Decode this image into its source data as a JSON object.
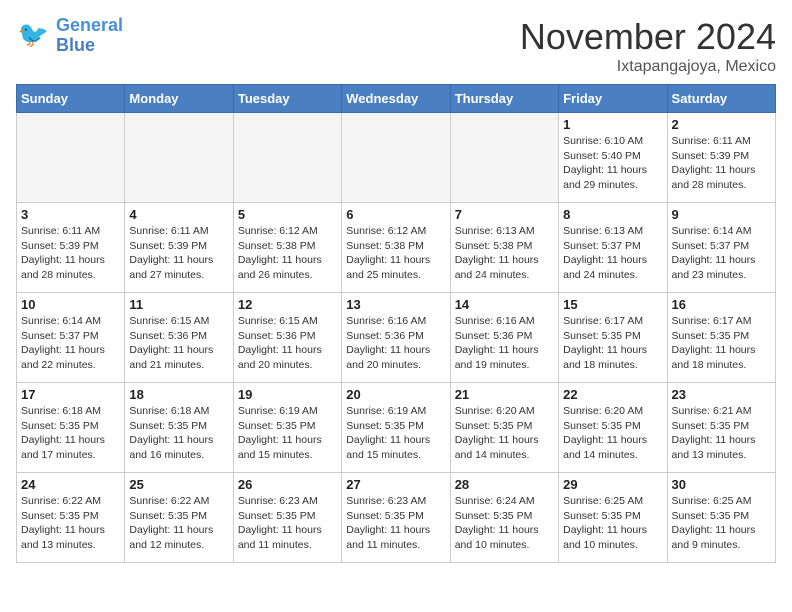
{
  "header": {
    "logo_line1": "General",
    "logo_line2": "Blue",
    "month_title": "November 2024",
    "location": "Ixtapangajoya, Mexico"
  },
  "weekdays": [
    "Sunday",
    "Monday",
    "Tuesday",
    "Wednesday",
    "Thursday",
    "Friday",
    "Saturday"
  ],
  "weeks": [
    [
      {
        "day": "",
        "info": ""
      },
      {
        "day": "",
        "info": ""
      },
      {
        "day": "",
        "info": ""
      },
      {
        "day": "",
        "info": ""
      },
      {
        "day": "",
        "info": ""
      },
      {
        "day": "1",
        "info": "Sunrise: 6:10 AM\nSunset: 5:40 PM\nDaylight: 11 hours and 29 minutes."
      },
      {
        "day": "2",
        "info": "Sunrise: 6:11 AM\nSunset: 5:39 PM\nDaylight: 11 hours and 28 minutes."
      }
    ],
    [
      {
        "day": "3",
        "info": "Sunrise: 6:11 AM\nSunset: 5:39 PM\nDaylight: 11 hours and 28 minutes."
      },
      {
        "day": "4",
        "info": "Sunrise: 6:11 AM\nSunset: 5:39 PM\nDaylight: 11 hours and 27 minutes."
      },
      {
        "day": "5",
        "info": "Sunrise: 6:12 AM\nSunset: 5:38 PM\nDaylight: 11 hours and 26 minutes."
      },
      {
        "day": "6",
        "info": "Sunrise: 6:12 AM\nSunset: 5:38 PM\nDaylight: 11 hours and 25 minutes."
      },
      {
        "day": "7",
        "info": "Sunrise: 6:13 AM\nSunset: 5:38 PM\nDaylight: 11 hours and 24 minutes."
      },
      {
        "day": "8",
        "info": "Sunrise: 6:13 AM\nSunset: 5:37 PM\nDaylight: 11 hours and 24 minutes."
      },
      {
        "day": "9",
        "info": "Sunrise: 6:14 AM\nSunset: 5:37 PM\nDaylight: 11 hours and 23 minutes."
      }
    ],
    [
      {
        "day": "10",
        "info": "Sunrise: 6:14 AM\nSunset: 5:37 PM\nDaylight: 11 hours and 22 minutes."
      },
      {
        "day": "11",
        "info": "Sunrise: 6:15 AM\nSunset: 5:36 PM\nDaylight: 11 hours and 21 minutes."
      },
      {
        "day": "12",
        "info": "Sunrise: 6:15 AM\nSunset: 5:36 PM\nDaylight: 11 hours and 20 minutes."
      },
      {
        "day": "13",
        "info": "Sunrise: 6:16 AM\nSunset: 5:36 PM\nDaylight: 11 hours and 20 minutes."
      },
      {
        "day": "14",
        "info": "Sunrise: 6:16 AM\nSunset: 5:36 PM\nDaylight: 11 hours and 19 minutes."
      },
      {
        "day": "15",
        "info": "Sunrise: 6:17 AM\nSunset: 5:35 PM\nDaylight: 11 hours and 18 minutes."
      },
      {
        "day": "16",
        "info": "Sunrise: 6:17 AM\nSunset: 5:35 PM\nDaylight: 11 hours and 18 minutes."
      }
    ],
    [
      {
        "day": "17",
        "info": "Sunrise: 6:18 AM\nSunset: 5:35 PM\nDaylight: 11 hours and 17 minutes."
      },
      {
        "day": "18",
        "info": "Sunrise: 6:18 AM\nSunset: 5:35 PM\nDaylight: 11 hours and 16 minutes."
      },
      {
        "day": "19",
        "info": "Sunrise: 6:19 AM\nSunset: 5:35 PM\nDaylight: 11 hours and 15 minutes."
      },
      {
        "day": "20",
        "info": "Sunrise: 6:19 AM\nSunset: 5:35 PM\nDaylight: 11 hours and 15 minutes."
      },
      {
        "day": "21",
        "info": "Sunrise: 6:20 AM\nSunset: 5:35 PM\nDaylight: 11 hours and 14 minutes."
      },
      {
        "day": "22",
        "info": "Sunrise: 6:20 AM\nSunset: 5:35 PM\nDaylight: 11 hours and 14 minutes."
      },
      {
        "day": "23",
        "info": "Sunrise: 6:21 AM\nSunset: 5:35 PM\nDaylight: 11 hours and 13 minutes."
      }
    ],
    [
      {
        "day": "24",
        "info": "Sunrise: 6:22 AM\nSunset: 5:35 PM\nDaylight: 11 hours and 13 minutes."
      },
      {
        "day": "25",
        "info": "Sunrise: 6:22 AM\nSunset: 5:35 PM\nDaylight: 11 hours and 12 minutes."
      },
      {
        "day": "26",
        "info": "Sunrise: 6:23 AM\nSunset: 5:35 PM\nDaylight: 11 hours and 11 minutes."
      },
      {
        "day": "27",
        "info": "Sunrise: 6:23 AM\nSunset: 5:35 PM\nDaylight: 11 hours and 11 minutes."
      },
      {
        "day": "28",
        "info": "Sunrise: 6:24 AM\nSunset: 5:35 PM\nDaylight: 11 hours and 10 minutes."
      },
      {
        "day": "29",
        "info": "Sunrise: 6:25 AM\nSunset: 5:35 PM\nDaylight: 11 hours and 10 minutes."
      },
      {
        "day": "30",
        "info": "Sunrise: 6:25 AM\nSunset: 5:35 PM\nDaylight: 11 hours and 9 minutes."
      }
    ]
  ]
}
